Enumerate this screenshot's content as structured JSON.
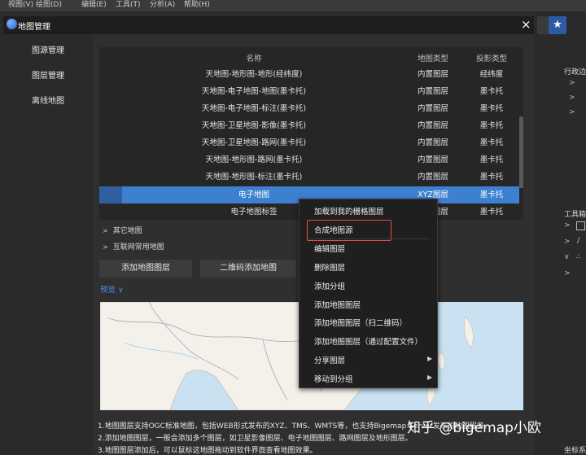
{
  "app": {
    "menu": [
      "视图(V)",
      "绘图(D)",
      "编辑(E)",
      "工具(T)",
      "分析(A)",
      "帮助(H)"
    ],
    "side_labels": {
      "admin": "行政边",
      "toolbox": "工具箱",
      "coord": "坐标系"
    }
  },
  "dialog": {
    "title": "地图管理",
    "close_glyph": "×",
    "nav": [
      "图源管理",
      "图层管理",
      "离线地图"
    ],
    "table": {
      "headers": [
        "名称",
        "地图类型",
        "投影类型"
      ],
      "rows": [
        [
          "天地图-地形图-地形(经纬度)",
          "内置图层",
          "经纬度"
        ],
        [
          "天地图-电子地图-地图(墨卡托)",
          "内置图层",
          "墨卡托"
        ],
        [
          "天地图-电子地图-标注(墨卡托)",
          "内置图层",
          "墨卡托"
        ],
        [
          "天地图-卫星地图-影像(墨卡托)",
          "内置图层",
          "墨卡托"
        ],
        [
          "天地图-卫星地图-路网(墨卡托)",
          "内置图层",
          "墨卡托"
        ],
        [
          "天地图-地形图-路网(墨卡托)",
          "内置图层",
          "墨卡托"
        ],
        [
          "天地图-地形图-标注(墨卡托)",
          "内置图层",
          "墨卡托"
        ],
        [
          "电子地图",
          "XYZ图层",
          "墨卡托"
        ],
        [
          "电子地图标签",
          "XYZ图层",
          "墨卡托"
        ]
      ],
      "selected_index": 7
    },
    "groups": [
      "其它地图",
      "互联网常用地图"
    ],
    "buttons": {
      "add_layer": "添加地图图层",
      "qr_add": "二维码添加地图"
    },
    "preview_label": "预览 ∨",
    "descriptions": [
      "1.地图图层支持OGC标准地图，包括WEB形式发布的XYZ、TMS、WMTS等，也支持Bigemap Server发布的地图服务。",
      "2.添加地图图层，一般会添加多个图层，如卫星影像图层、电子地图图层、路网图层及地形图层。",
      "3.地图图层添加后，可以鼠标这地图拖动到软件界面查看地图效果。"
    ]
  },
  "context_menu": {
    "items": [
      {
        "label": "加载到我的栅格图层",
        "submenu": false
      },
      {
        "label": "合成地图源",
        "submenu": false,
        "highlighted": true
      },
      {
        "label": "编辑图层",
        "submenu": false
      },
      {
        "label": "删除图层",
        "submenu": false
      },
      {
        "label": "添加分组",
        "submenu": false
      },
      {
        "label": "添加地图图层",
        "submenu": false
      },
      {
        "label": "添加地图图层（扫二维码）",
        "submenu": false
      },
      {
        "label": "添加地图图层（通过配置文件）",
        "submenu": false
      },
      {
        "label": "分享图层",
        "submenu": true
      },
      {
        "label": "移动到分组",
        "submenu": true
      }
    ]
  },
  "watermark": "知乎 @bigemap小欧",
  "colors": {
    "accent": "#3e80d0",
    "highlight_box": "#e84a4a",
    "preview_link": "#4a8fe7"
  }
}
